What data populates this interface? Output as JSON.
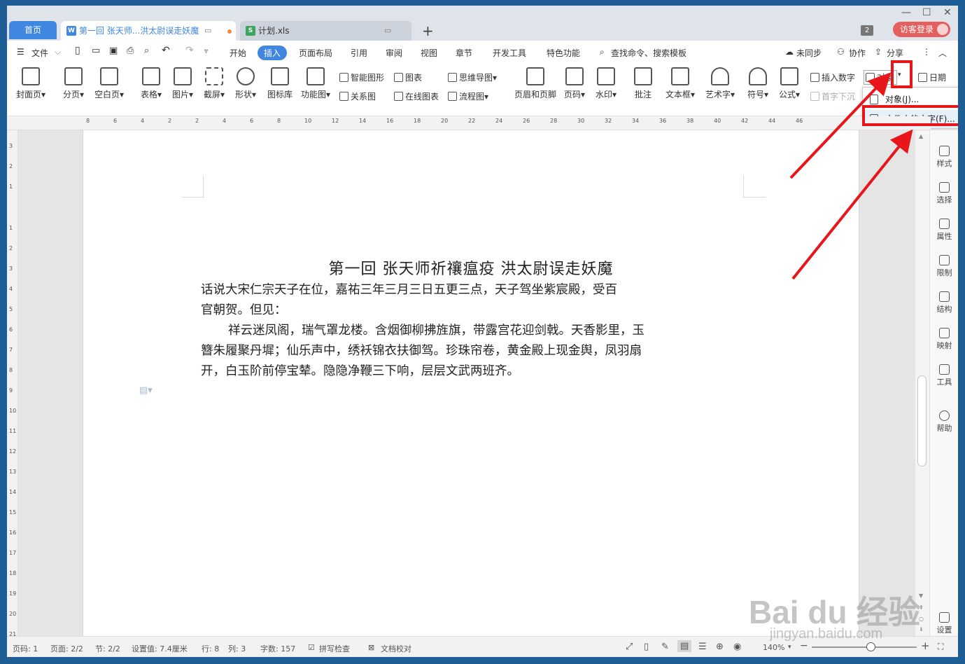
{
  "tabs": {
    "home": "首页",
    "doc": "第一回 张天师...洪太尉误走妖魔",
    "sheet": "计划.xls",
    "doc_icon": "W",
    "sheet_icon": "S"
  },
  "titlebar": {
    "count": "2",
    "login": "访客登录"
  },
  "menu": {
    "file": "文件",
    "start": "开始",
    "insert": "插入",
    "layout": "页面布局",
    "ref": "引用",
    "review": "审阅",
    "view": "视图",
    "chapter": "章节",
    "dev": "开发工具",
    "special": "特色功能",
    "search": "查找命令、搜索模板",
    "sync": "未同步",
    "collab": "协作",
    "share": "分享"
  },
  "ribbon": {
    "cover": "封面页",
    "pagebreak": "分页",
    "blank": "空白页",
    "table": "表格",
    "image": "图片",
    "screenshot": "截屏",
    "shape": "形状",
    "iconlib": "图标库",
    "funcchart": "功能图",
    "smartart": "智能图形",
    "chart": "图表",
    "mindmap": "思维导图",
    "relation": "关系图",
    "onlinechart": "在线图表",
    "flowchart": "流程图",
    "headerfooter": "页眉和页脚",
    "pagenum": "页码",
    "watermark": "水印",
    "comment": "批注",
    "textbox": "文本框",
    "wordart": "艺术字",
    "symbol": "符号",
    "formula": "公式",
    "insertnum": "插入数字",
    "object": "对象",
    "date": "日期",
    "dropcap": "首字下沉"
  },
  "dropdown": {
    "item1": "对象(J)...",
    "item2": "文件中的文字(F)..."
  },
  "ruler": {
    "labels": [
      "8",
      "6",
      "4",
      "2",
      "2",
      "4",
      "6",
      "8",
      "10",
      "12",
      "14",
      "16",
      "18",
      "20",
      "22",
      "24",
      "26",
      "28",
      "30",
      "32",
      "34",
      "36",
      "38",
      "40",
      "42",
      "44",
      "46"
    ],
    "vlabels": [
      "3",
      "2",
      "1",
      "1",
      "2",
      "3",
      "4",
      "5",
      "6",
      "7",
      "8",
      "9",
      "10",
      "11",
      "12",
      "13",
      "14",
      "15",
      "16",
      "17",
      "18",
      "19",
      "20",
      "21"
    ]
  },
  "document": {
    "title": "第一回  张天师祈禳瘟疫    洪太尉误走妖魔",
    "p1a": "话说大宋仁宗天子在位，嘉祐三年三月三日五更三点，天子驾坐紫宸殿，受百",
    "p1b": "官朝贺。但见：",
    "p2a": "祥云迷凤阁，瑞气罩龙楼。含烟御柳拂旌旗，带露宫花迎剑戟。天香影里，玉",
    "p2b": "簪朱履聚丹墀；仙乐声中，绣袄锦衣扶御驾。珍珠帘卷，黄金殿上现金舆，凤羽扇",
    "p2c": "开，白玉阶前停宝辇。隐隐净鞭三下响，层层文武两班齐。"
  },
  "side": {
    "style": "样式",
    "select": "选择",
    "attr": "属性",
    "limit": "限制",
    "struct": "结构",
    "map": "映射",
    "tools": "工具",
    "help": "帮助",
    "settings": "设置"
  },
  "status": {
    "pagenum": "页码: 1",
    "pages": "页面: 2/2",
    "section": "节: 2/2",
    "setting": "设置值: 7.4厘米",
    "row": "行: 8",
    "col": "列: 3",
    "words": "字数: 157",
    "spell": "拼写检查",
    "proof": "文档校对",
    "zoom": "140%"
  },
  "watermark": {
    "brand": "Bai du 经验",
    "url": "jingyan.baidu.com"
  },
  "colors": {
    "accent": "#3f87e0",
    "highlight": "#e8161b"
  }
}
